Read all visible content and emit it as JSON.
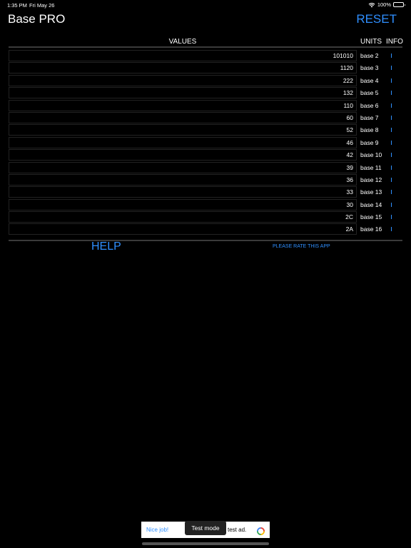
{
  "status": {
    "time": "1:35 PM",
    "date": "Fri May 26",
    "battery": "100%"
  },
  "header": {
    "title": "Base PRO",
    "reset_label": "RESET"
  },
  "columns": {
    "values": "VALUES",
    "units": "UNITS",
    "info": "INFO"
  },
  "rows": [
    {
      "value": "101010",
      "unit": "base 2"
    },
    {
      "value": "1120",
      "unit": "base 3"
    },
    {
      "value": "222",
      "unit": "base 4"
    },
    {
      "value": "132",
      "unit": "base 5"
    },
    {
      "value": "110",
      "unit": "base 6"
    },
    {
      "value": "60",
      "unit": "base 7"
    },
    {
      "value": "52",
      "unit": "base 8"
    },
    {
      "value": "46",
      "unit": "base 9"
    },
    {
      "value": "42",
      "unit": "base 10"
    },
    {
      "value": "39",
      "unit": "base 11"
    },
    {
      "value": "36",
      "unit": "base 12"
    },
    {
      "value": "33",
      "unit": "base 13"
    },
    {
      "value": "30",
      "unit": "base 14"
    },
    {
      "value": "2C",
      "unit": "base 15"
    },
    {
      "value": "2A",
      "unit": "base 16"
    }
  ],
  "footer": {
    "help_label": "HELP",
    "rate_label": "PLEASE RATE THIS APP"
  },
  "ad": {
    "left_text": "Nice job!",
    "right_text": "test ad.",
    "toast": "Test mode"
  },
  "colors": {
    "accent": "#2f8fff",
    "background": "#000000"
  }
}
